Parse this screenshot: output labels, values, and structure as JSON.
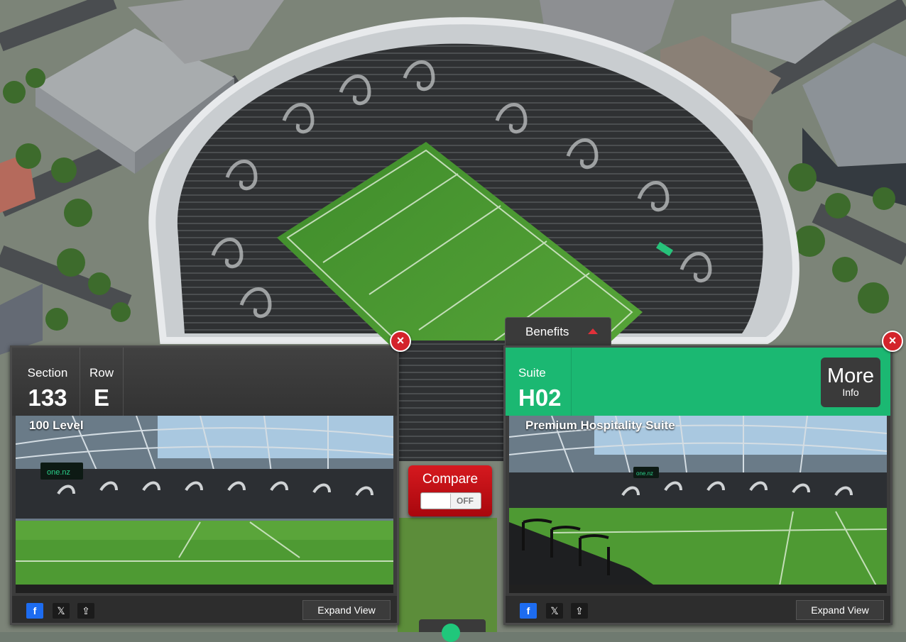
{
  "left_panel": {
    "section_label": "Section",
    "section_value": "133",
    "row_label": "Row",
    "row_value": "E",
    "level": "100 Level",
    "expand_label": "Expand View",
    "close_symbol": "×",
    "board_text": "one.nz"
  },
  "right_panel": {
    "suite_label": "Suite",
    "suite_value": "H02",
    "level": "Premium Hospitality Suite",
    "more_label": "More",
    "more_sub": "Info",
    "expand_label": "Expand View",
    "close_symbol": "×",
    "benefits_label": "Benefits",
    "board_text": "one.nz"
  },
  "compare": {
    "label": "Compare",
    "state": "OFF"
  },
  "share_icons": {
    "facebook": "f",
    "x": "𝕏",
    "share": "⇪"
  },
  "colors": {
    "suite_green": "#1bb872",
    "compare_red": "#d6191f",
    "close_red": "#d3232b",
    "facebook_blue": "#1d6cf0"
  }
}
